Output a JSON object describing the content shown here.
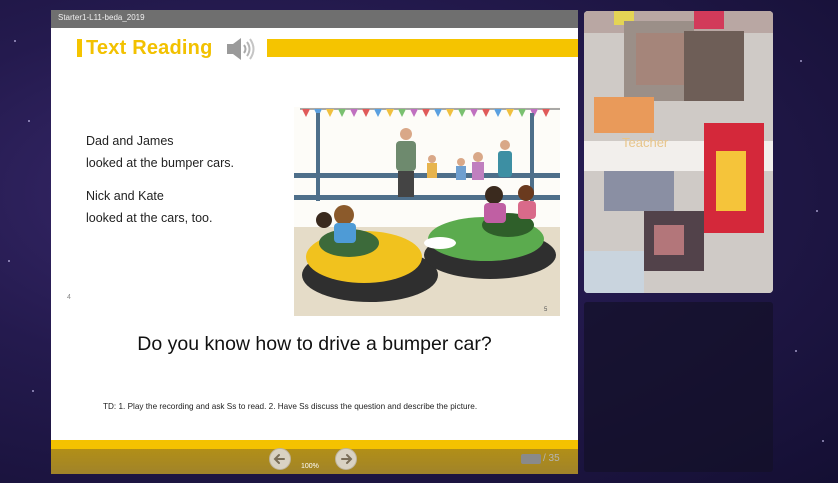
{
  "window": {
    "title": "Starter1-L11-beda_2019"
  },
  "slide": {
    "header_title": "Text Reading",
    "text_lines": [
      "Dad and James",
      "looked at the bumper cars.",
      "Nick and Kate",
      "looked at the cars, too."
    ],
    "question": "Do you know how to drive a bumper car?",
    "teacher_note": "TD: 1. Play the recording and ask Ss to read.  2. Have Ss discuss the question and describe the picture.",
    "page_mark_left": "4",
    "page_mark_right": "5"
  },
  "toolbar": {
    "zoom": "100%",
    "page_total": "/ 35",
    "prev_icon": "arrow-left-icon",
    "next_icon": "arrow-right-icon"
  },
  "teacher_video": {
    "label": "Teacher"
  },
  "colors": {
    "accent_yellow": "#f5c400",
    "titlebar": "#6f6f6f",
    "background": "#241a4e"
  }
}
